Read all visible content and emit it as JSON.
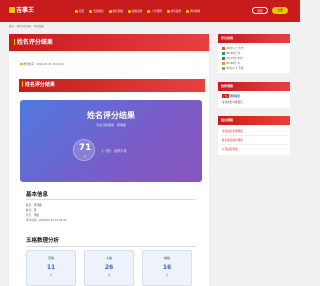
{
  "header": {
    "logo": "吉事王",
    "nav": [
      {
        "label": "首页",
        "icon": "home-icon"
      },
      {
        "label": "宝宝取名",
        "icon": "baby-icon"
      },
      {
        "label": "姓名测试",
        "icon": "name-icon"
      },
      {
        "label": "星座运势",
        "icon": "star-icon"
      },
      {
        "label": "八字测算",
        "icon": "calendar-icon"
      },
      {
        "label": "生肖运势",
        "icon": "zodiac-icon"
      },
      {
        "label": "周公解梦",
        "icon": "dream-icon"
      }
    ],
    "login": "登录",
    "register": "注册"
  },
  "breadcrumb": [
    "首页",
    "姓名评分测试",
    "测试结果"
  ],
  "main": {
    "title": "姓名评分结果",
    "meta": "检测时间：2026-03-01 15:42:22",
    "inner_title": "姓名评分结果",
    "hero": {
      "title": "姓名评分结果",
      "subtitle": "专业分析报告 · 周泽媛",
      "score": "71",
      "score_unit": "分",
      "level": "【一般】 运势平稳"
    },
    "basic": {
      "title": "基本信息",
      "rows": [
        "姓名：周泽媛",
        "姓氏：周",
        "名字：泽媛",
        "评分时间：2026-03-01 15:42:22"
      ]
    },
    "wuge": {
      "title": "五格数理分析",
      "items": [
        {
          "label": "天格",
          "num": "11",
          "unit": "吉"
        },
        {
          "label": "人格",
          "num": "26",
          "unit": "凶"
        },
        {
          "label": "地格",
          "num": "16",
          "unit": "吉"
        }
      ]
    }
  },
  "sidebar": {
    "legend_title": "评分说明",
    "legend": [
      {
        "label": "90分以上 大吉",
        "color": "#d9534f"
      },
      {
        "label": "80-89分 吉",
        "color": "#2e9e4f"
      },
      {
        "label": "70-79分 中吉",
        "color": "#3a66c8"
      },
      {
        "label": "60-69分 平",
        "color": "#e6a100"
      },
      {
        "label": "60分以下 不佳",
        "color": "#999999"
      }
    ],
    "ad_title": "推荐测算",
    "ad_badge": "广告",
    "ad_name": "测算服务",
    "ad_desc": "专业姓名详批报告",
    "links_title": "相关测算",
    "links": [
      "宝宝起名免费测试",
      "姓名配对缘分测试",
      "公司起名测试"
    ]
  }
}
